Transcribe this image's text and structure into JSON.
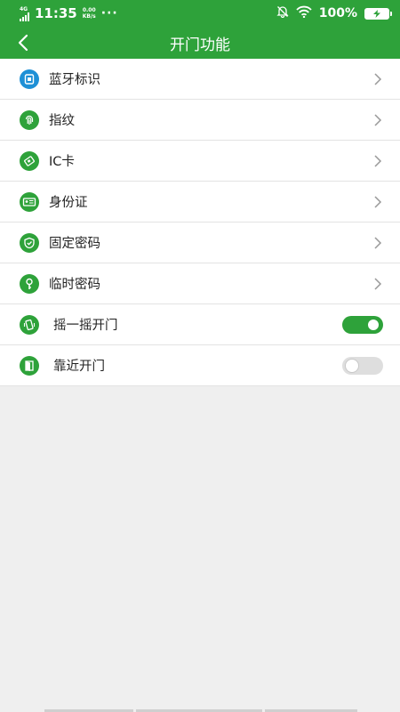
{
  "status_bar": {
    "network": "4G",
    "network_sub": "HD",
    "time": "11:35",
    "speed_value": "0.00",
    "speed_unit": "KB/s",
    "more": "···",
    "battery": "100%"
  },
  "header": {
    "title": "开门功能",
    "back_icon": "chevron-left-icon"
  },
  "menu_items": [
    {
      "label": "蓝牙标识",
      "icon": "bluetooth-tag-icon",
      "icon_color": "#1e90d6"
    },
    {
      "label": "指纹",
      "icon": "fingerprint-icon",
      "icon_color": "#2ea23a"
    },
    {
      "label": "IC卡",
      "icon": "ic-card-icon",
      "icon_color": "#2ea23a"
    },
    {
      "label": "身份证",
      "icon": "id-card-icon",
      "icon_color": "#2ea23a"
    },
    {
      "label": "固定密码",
      "icon": "shield-icon",
      "icon_color": "#2ea23a"
    },
    {
      "label": "临时密码",
      "icon": "key-icon",
      "icon_color": "#2ea23a"
    }
  ],
  "toggles": [
    {
      "label": "摇一摇开门",
      "icon": "shake-phone-icon",
      "state": "on"
    },
    {
      "label": "靠近开门",
      "icon": "door-icon",
      "state": "off"
    }
  ],
  "colors": {
    "brand": "#2ea23a",
    "bluetooth_icon": "#1e90d6",
    "background": "#efefef"
  }
}
